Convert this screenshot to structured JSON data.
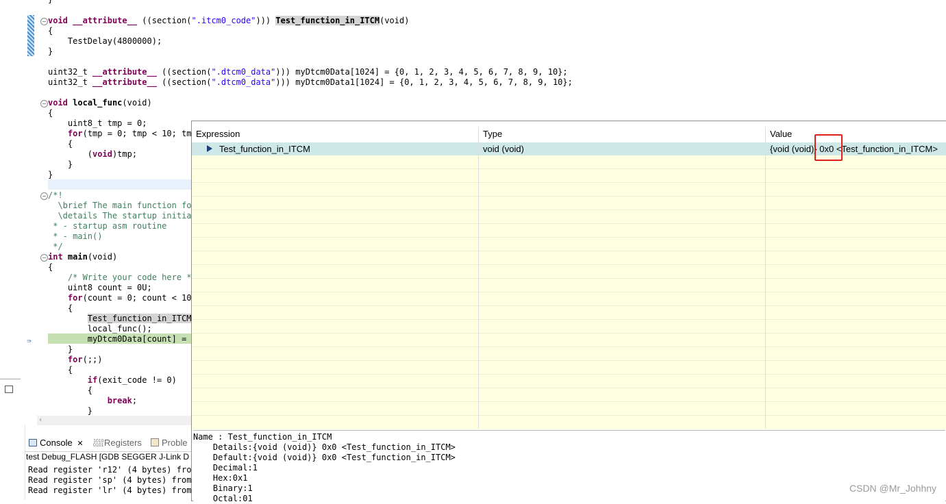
{
  "code": {
    "line_top": "}",
    "itcm_decl_prefix": "void",
    "itcm_attr": "__attribute__",
    "itcm_paren": " ((section(",
    "itcm_section": "\".itcm0_code\"",
    "itcm_close": "))) ",
    "itcm_name": "Test_function_in_ITCM",
    "itcm_args": "(void)",
    "brace_open": "{",
    "delay_call": "TestDelay(4800000);",
    "brace_close": "}",
    "dtcm1_type": "uint32_t",
    "dtcm_attr": "__attribute__",
    "dtcm_paren": " ((section(",
    "dtcm_section": "\".dtcm0_data\"",
    "dtcm1_rest": "))) myDtcm0Data[1024] = {0, 1, 2, 3, 4, 5, 6, 7, 8, 9, 10};",
    "dtcm2_rest": "))) myDtcm0Data1[1024] = {0, 1, 2, 3, 4, 5, 6, 7, 8, 9, 10};",
    "local_kw": "void",
    "local_name": "local_func",
    "local_args": "(void)",
    "tmp_decl": "uint8_t tmp = 0;",
    "for_kw": "for",
    "for_rest": "(tmp = 0; tmp < 10; tmp",
    "void_cast_kw": "void",
    "void_cast_rest": "tmp;",
    "cmt_open": "/*!",
    "cmt_brief": "  \\brief The main function for",
    "cmt_details": "  \\details The startup initial",
    "cmt_startup": " * - startup asm routine",
    "cmt_main": " * - main()",
    "cmt_close": " */",
    "main_kw": "int",
    "main_name": "main",
    "main_args": "(void)",
    "write_cmt": "/* Write your code here */",
    "count_decl": "uint8 count = 0U;",
    "for2_rest": "(count = 0; count < 10;",
    "call_itcm": "Test_function_in_ITCM(",
    "call_local": "local_func();",
    "assign_line": "myDtcm0Data[count] = m",
    "for3_rest": "(;;)",
    "if_kw": "if",
    "if_rest": "(exit_code != 0)",
    "break_kw": "break",
    "break_semi": ";"
  },
  "bottom": {
    "tab_console": "Console",
    "tab_console_close": "✕",
    "tab_registers": "Registers",
    "tab_problems": "Proble",
    "console_title": "test Debug_FLASH [GDB SEGGER J-Link D",
    "console_lines": [
      "Read register 'r12' (4 bytes) from",
      "Read register 'sp' (4 bytes) from",
      "Read register 'lr' (4 bytes) from"
    ]
  },
  "popup": {
    "headers": [
      "Expression",
      "Type",
      "Value"
    ],
    "row": {
      "expression": "Test_function_in_ITCM",
      "type": "void (void)",
      "value": "{void (void)} 0x0 <Test_function_in_ITCM>"
    },
    "details": [
      "Name : Test_function_in_ITCM",
      "    Details:{void (void)} 0x0 <Test_function_in_ITCM>",
      "    Default:{void (void)} 0x0 <Test_function_in_ITCM>",
      "    Decimal:1",
      "    Hex:0x1",
      "    Binary:1",
      "    Octal:01"
    ]
  },
  "watermark": "CSDN @Mr_Johhny",
  "colors": {
    "keyword": "#7f0055",
    "string": "#2a00ff",
    "comment": "#3f7f5f",
    "highlight_box": "#e0201b",
    "popup_bg": "#ffffe1",
    "selected_row": "#cde8e6"
  },
  "icons": [
    "console-icon",
    "registers-icon",
    "problems-icon",
    "debug-arrow-icon",
    "expression-arrow-icon"
  ]
}
